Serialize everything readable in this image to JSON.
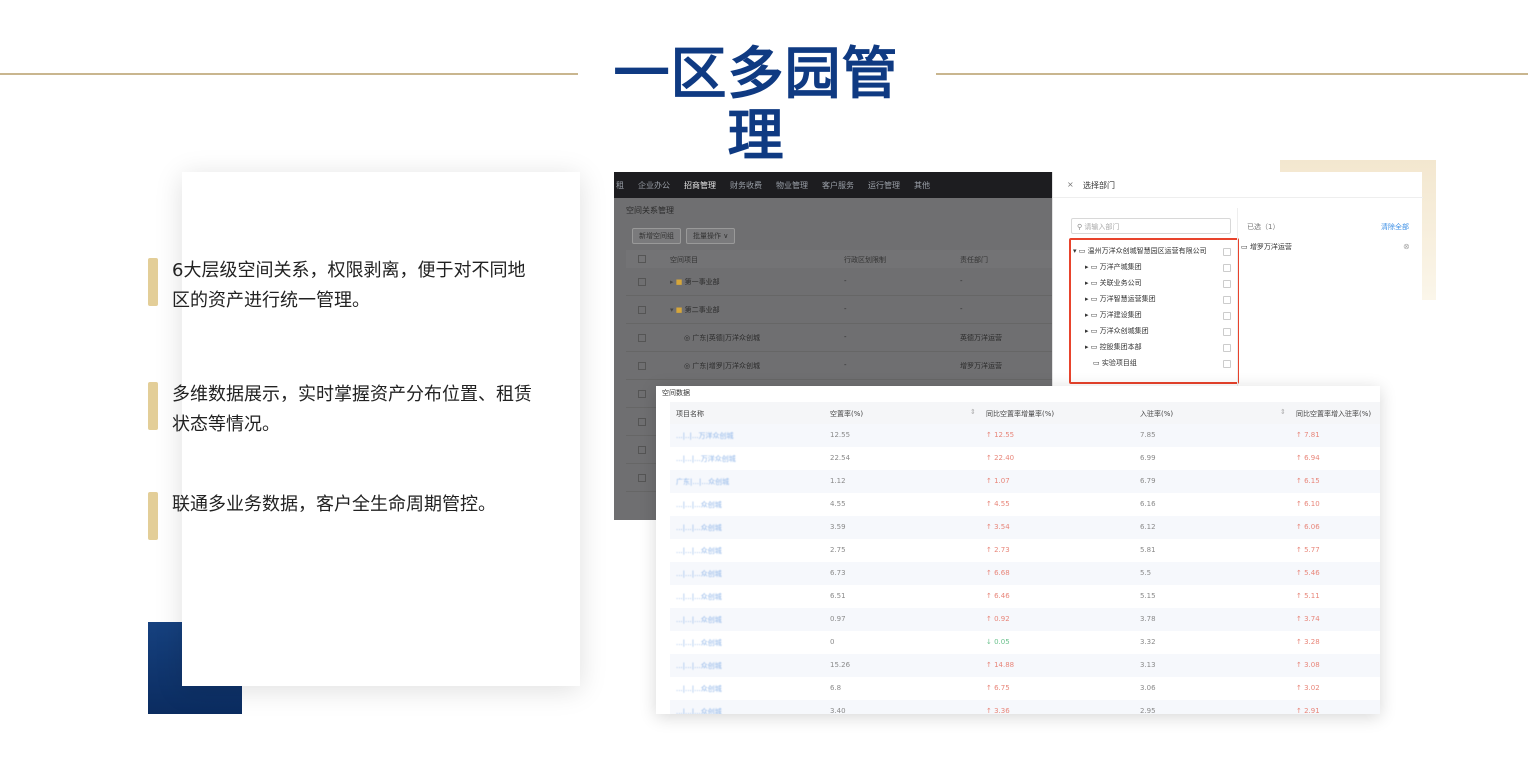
{
  "title": "一区多园管理",
  "features": [
    {
      "text": "6大层级空间关系，权限剥离，便于对不同地区的资产进行统一管理。"
    },
    {
      "text": "多维数据展示，实时掌握资产分布位置、租赁状态等情况。"
    },
    {
      "text": "联通多业务数据，客户全生命周期管控。"
    }
  ],
  "app": {
    "nav": [
      "租",
      "企业办公",
      "招商管理",
      "财务收费",
      "物业管理",
      "客户服务",
      "运行管理",
      "其他"
    ],
    "nav_active_index": 2,
    "breadcrumb": "空间关系管理",
    "buttons": [
      "新增空间组",
      "批量操作 ∨"
    ],
    "columns": [
      "空间项目",
      "行政区划限制",
      "责任部门"
    ],
    "rows": [
      {
        "name": "第一事业部",
        "region": "-",
        "dept": "-",
        "type": "folder",
        "expanded": false
      },
      {
        "name": "第二事业部",
        "region": "-",
        "dept": "-",
        "type": "folder",
        "expanded": true
      },
      {
        "name": "广东|英德|万洋众创城",
        "region": "-",
        "dept": "英德万洋运营",
        "type": "project"
      },
      {
        "name": "广东|增罗|万洋众创城",
        "region": "-",
        "dept": "增罗万洋运营",
        "type": "project"
      }
    ]
  },
  "drawer": {
    "close_icon": "×",
    "title": "选择部门",
    "search_placeholder": "请输入部门",
    "tree_root": "温州万洋众创城智慧园区运营有限公司",
    "tree_children": [
      "万洋产城集团",
      "关联业务公司",
      "万洋智慧运营集团",
      "万洋建设集团",
      "万洋众创城集团",
      "控股集团本部",
      "实验项目组"
    ],
    "selected_header": "已选（1）",
    "clear_label": "清除全部",
    "selected_item": "增罗万洋运营"
  },
  "table": {
    "title": "空间数据",
    "columns": [
      "项目名称",
      "空置率(%)",
      "同比空置率增量率(%)",
      "入驻率(%)",
      "同比空置率增入驻率(%)"
    ],
    "rows": [
      {
        "name": "...|..|...万洋众创城",
        "vac": "12.55",
        "vac_yoy": "↑ 12.55",
        "occ": "7.85",
        "occ_yoy": "↑ 7.81",
        "green": false
      },
      {
        "name": "...|...|...万洋众创城",
        "vac": "22.54",
        "vac_yoy": "↑ 22.40",
        "occ": "6.99",
        "occ_yoy": "↑ 6.94",
        "green": false
      },
      {
        "name": "广东|...|...众创城",
        "vac": "1.12",
        "vac_yoy": "↑ 1.07",
        "occ": "6.79",
        "occ_yoy": "↑ 6.15",
        "green": false
      },
      {
        "name": "...|...|...众创城",
        "vac": "4.55",
        "vac_yoy": "↑ 4.55",
        "occ": "6.16",
        "occ_yoy": "↑ 6.10",
        "green": false
      },
      {
        "name": "...|...|...众创城",
        "vac": "3.59",
        "vac_yoy": "↑ 3.54",
        "occ": "6.12",
        "occ_yoy": "↑ 6.06",
        "green": false
      },
      {
        "name": "...|...|...众创城",
        "vac": "2.75",
        "vac_yoy": "↑ 2.73",
        "occ": "5.81",
        "occ_yoy": "↑ 5.77",
        "green": false
      },
      {
        "name": "...|...|...众创城",
        "vac": "6.73",
        "vac_yoy": "↑ 6.68",
        "occ": "5.5",
        "occ_yoy": "↑ 5.46",
        "green": false
      },
      {
        "name": "...|...|...众创城",
        "vac": "6.51",
        "vac_yoy": "↑ 6.46",
        "occ": "5.15",
        "occ_yoy": "↑ 5.11",
        "green": false
      },
      {
        "name": "...|...|...众创城",
        "vac": "0.97",
        "vac_yoy": "↑ 0.92",
        "occ": "3.78",
        "occ_yoy": "↑ 3.74",
        "green": false
      },
      {
        "name": "...|...|...众创城",
        "vac": "0",
        "vac_yoy": "↓ 0.05",
        "occ": "3.32",
        "occ_yoy": "↑ 3.28",
        "green": true
      },
      {
        "name": "...|...|...众创城",
        "vac": "15.26",
        "vac_yoy": "↑ 14.88",
        "occ": "3.13",
        "occ_yoy": "↑ 3.08",
        "green": false
      },
      {
        "name": "...|...|...众创城",
        "vac": "6.8",
        "vac_yoy": "↑ 6.75",
        "occ": "3.06",
        "occ_yoy": "↑ 3.02",
        "green": false
      },
      {
        "name": "...|...|...众创城",
        "vac": "3.40",
        "vac_yoy": "↑ 3.36",
        "occ": "2.95",
        "occ_yoy": "↑ 2.91",
        "green": false
      }
    ]
  }
}
